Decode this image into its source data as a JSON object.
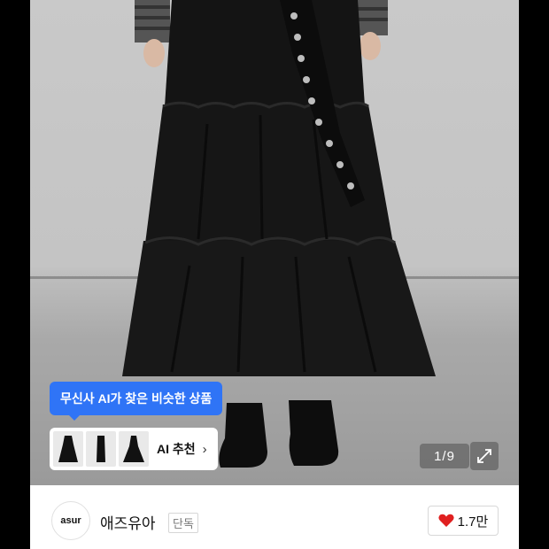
{
  "ai_recommend": {
    "bubble_text": "무신사 AI가 찾은 비슷한 상품",
    "button_label": "AI 추천",
    "chevron": "›"
  },
  "gallery": {
    "pager": "1/9",
    "expand_icon": "expand-icon"
  },
  "brand": {
    "logo_text": "asur",
    "name": "애즈유아",
    "badge": "단독"
  },
  "like": {
    "count": "1.7만",
    "heart_color": "#e02020"
  },
  "colors": {
    "accent": "#2f74f6"
  }
}
